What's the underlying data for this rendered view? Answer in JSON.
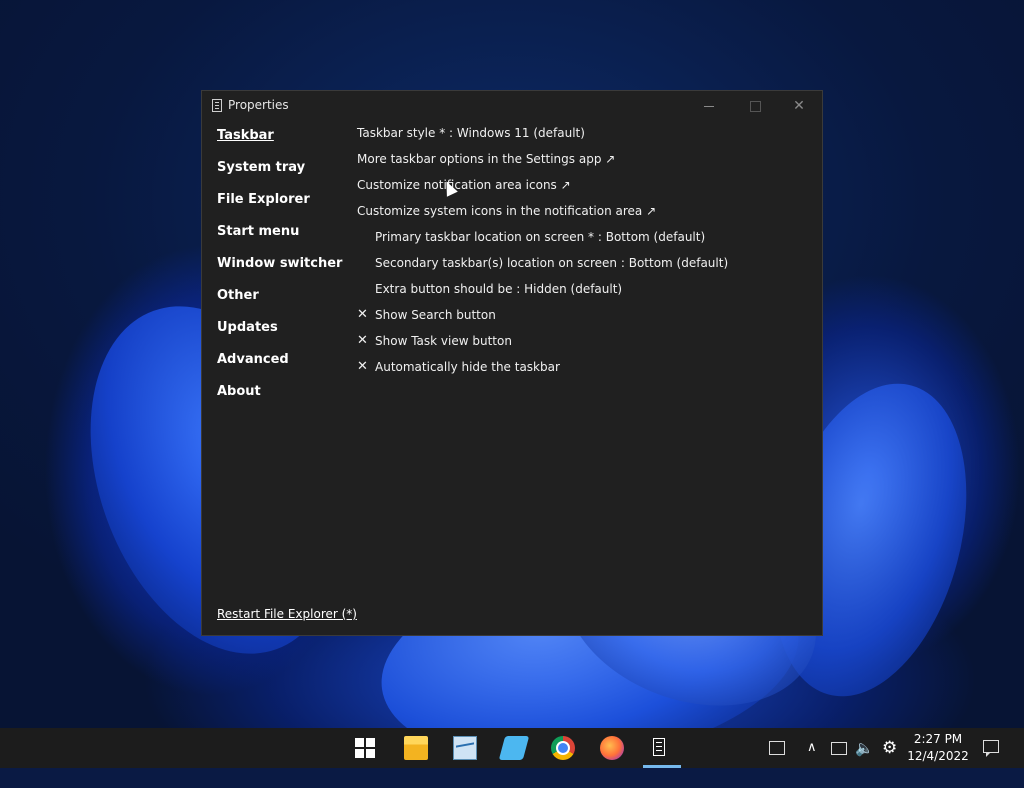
{
  "window": {
    "title": "Properties",
    "controls": {
      "minimize": "—",
      "close": "✕"
    }
  },
  "sidebar": {
    "items": [
      {
        "label": "Taskbar",
        "active": true
      },
      {
        "label": "System tray"
      },
      {
        "label": "File Explorer"
      },
      {
        "label": "Start menu"
      },
      {
        "label": "Window switcher"
      },
      {
        "label": "Other"
      },
      {
        "label": "Updates"
      },
      {
        "label": "Advanced"
      },
      {
        "label": "About"
      }
    ],
    "restart_link": "Restart File Explorer (*)"
  },
  "content": {
    "rows": [
      {
        "label": "Taskbar style * : Windows 11 (default)"
      },
      {
        "label": "More taskbar options in the Settings app ↗"
      },
      {
        "label": "Customize notification area icons ↗"
      },
      {
        "label": "Customize system icons in the notification area ↗"
      },
      {
        "label": "Primary taskbar location on screen * : Bottom (default)"
      },
      {
        "label": "Secondary taskbar(s) location on screen : Bottom (default)"
      },
      {
        "label": "Extra button should be : Hidden (default)"
      },
      {
        "label": "Show Search button",
        "mark": "✕"
      },
      {
        "label": "Show Task view button",
        "mark": "✕"
      },
      {
        "label": "Automatically hide the taskbar",
        "mark": "✕"
      }
    ]
  },
  "taskbar": {
    "tray": {
      "chevron": "∧",
      "volume": "🔈",
      "gear": "⚙"
    },
    "clock": {
      "time": "2:27 PM",
      "date": "12/4/2022"
    }
  },
  "colors": {
    "window_bg": "#202020",
    "taskbar_bg": "#1c1c1c",
    "accent": "#76b9ed"
  }
}
